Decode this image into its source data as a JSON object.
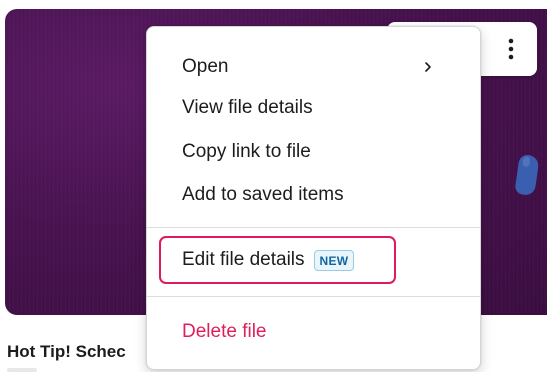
{
  "file_card": {
    "title": "Hot Tip! Schec",
    "more_icon": "vertical-ellipsis-icon"
  },
  "context_menu": {
    "items": [
      {
        "label": "Open",
        "has_submenu": true,
        "submenu_icon": "chevron-right-icon"
      },
      {
        "label": "View file details"
      },
      {
        "label": "Copy link to file"
      },
      {
        "label": "Add to saved items"
      }
    ],
    "edit_item": {
      "label": "Edit file details",
      "badge": "NEW",
      "highlight_color": "#dd1b5b"
    },
    "danger_item": {
      "label": "Delete file",
      "color": "#e01e5a"
    }
  },
  "colors": {
    "card_purple": "#48124f",
    "badge_blue": "#1264a3"
  }
}
